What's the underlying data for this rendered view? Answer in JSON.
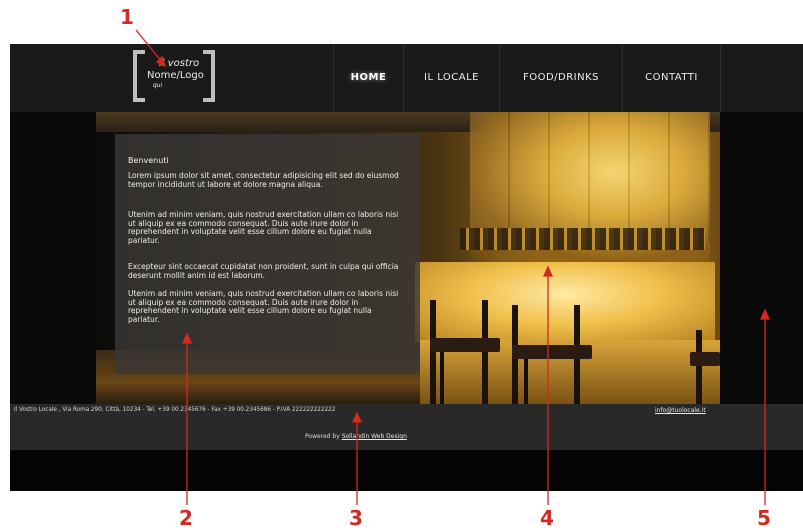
{
  "header": {
    "logo": {
      "line1": "il vostro",
      "line2": "Nome/Logo",
      "line3": "qui"
    },
    "nav": [
      {
        "label": "HOME",
        "active": true
      },
      {
        "label": "IL LOCALE",
        "active": false
      },
      {
        "label": "FOOD/DRINKS",
        "active": false
      },
      {
        "label": "CONTATTI",
        "active": false
      }
    ]
  },
  "content": {
    "welcome": "Benvenuti",
    "paragraphs": [
      "Lorem ipsum dolor sit amet, consectetur adipisicing elit sed do eiusmod tempor incididunt ut labore et dolore magna aliqua.",
      "Utenim ad minim veniam, quis nostrud exercitation ullam co laboris nisi ut aliquip ex ea commodo consequat. Duis aute irure dolor in reprehendent in voluptate velit esse cillum dolore eu fugiat nulla pariatur.",
      "Excepteur sint occaecat cupidatat non proident, sunt in culpa qui officia deserunt mollit anim id est laborum.",
      "Utenim ad minim veniam, quis nostrud exercitation ullam co laboris nisi ut aliquip ex ea commodo consequat. Duis aute irure dolor in reprehendent in voluptate velit esse cillum dolore eu fugiat nulla pariatur."
    ]
  },
  "footer": {
    "address": "Il Vostro Locale , Via Roma 290, Città, 10234 - Tel. +39 00.2345676 - Fax +39 00.2345686 - P.IVA 222222222222",
    "email": "info@tuolocale.it",
    "powered_prefix": "Powered by",
    "powered_link": "Sollandin Web Design"
  },
  "callouts": [
    "1",
    "2",
    "3",
    "4",
    "5"
  ],
  "colors": {
    "header_bg": "#1b1a1a",
    "content_overlay": "#3a3836",
    "footer_bg": "#2a2929",
    "callout_red": "#d32a1f",
    "bar_gold": "#f0c04c"
  }
}
